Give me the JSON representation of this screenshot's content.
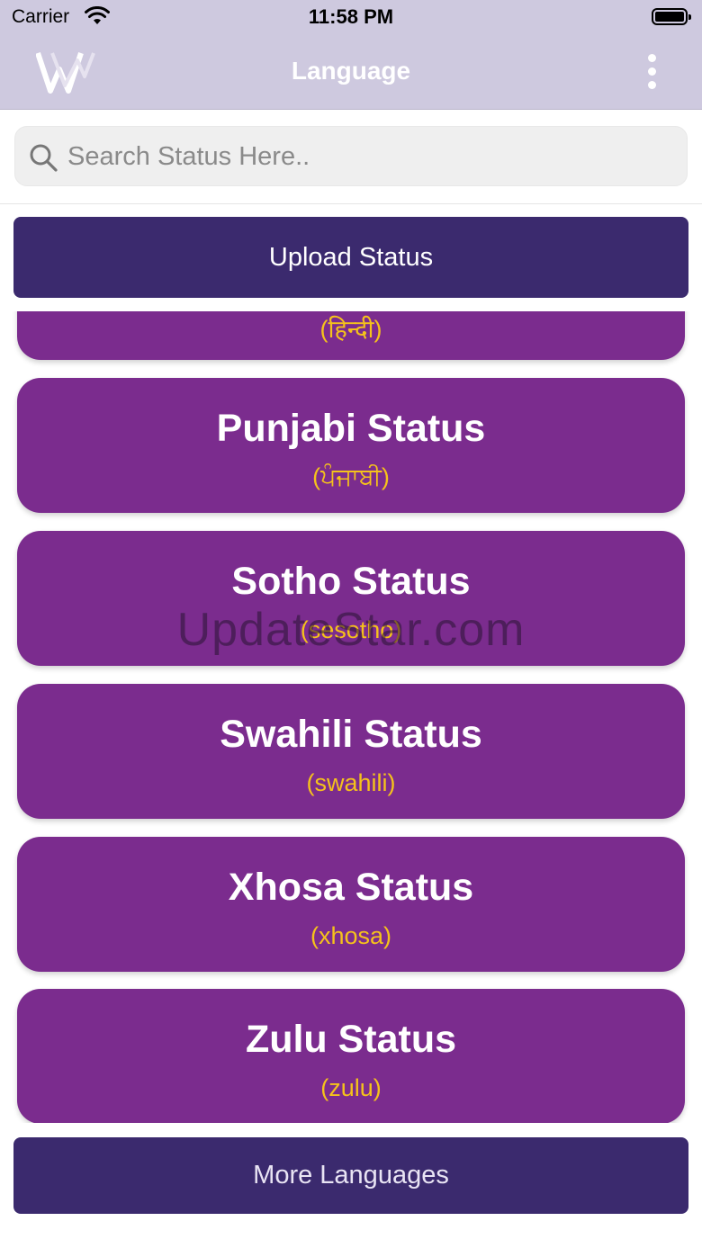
{
  "status_bar": {
    "carrier": "Carrier",
    "time": "11:58 PM"
  },
  "nav": {
    "title": "Language",
    "logo_icon": "w-logo-icon",
    "menu_icon": "more-vertical-icon"
  },
  "search": {
    "placeholder": "Search Status Here..",
    "value": ""
  },
  "upload_button": {
    "label": "Upload Status"
  },
  "languages": [
    {
      "title": "",
      "subtitle": "(हिन्दी)"
    },
    {
      "title": "Punjabi Status",
      "subtitle": "(ਪੰਜਾਬੀ)"
    },
    {
      "title": "Sotho Status",
      "subtitle": "(sesotho)"
    },
    {
      "title": "Swahili Status",
      "subtitle": "(swahili)"
    },
    {
      "title": "Xhosa Status",
      "subtitle": "(xhosa)"
    },
    {
      "title": "Zulu Status",
      "subtitle": "(zulu)"
    }
  ],
  "more_button": {
    "label": "More Languages"
  },
  "watermark": "UpdateStar.com",
  "colors": {
    "card_bg": "#7b2c8e",
    "subtitle": "#f5c21b",
    "button_bg": "#3b2a6e",
    "nav_bg": "#cec9df"
  }
}
